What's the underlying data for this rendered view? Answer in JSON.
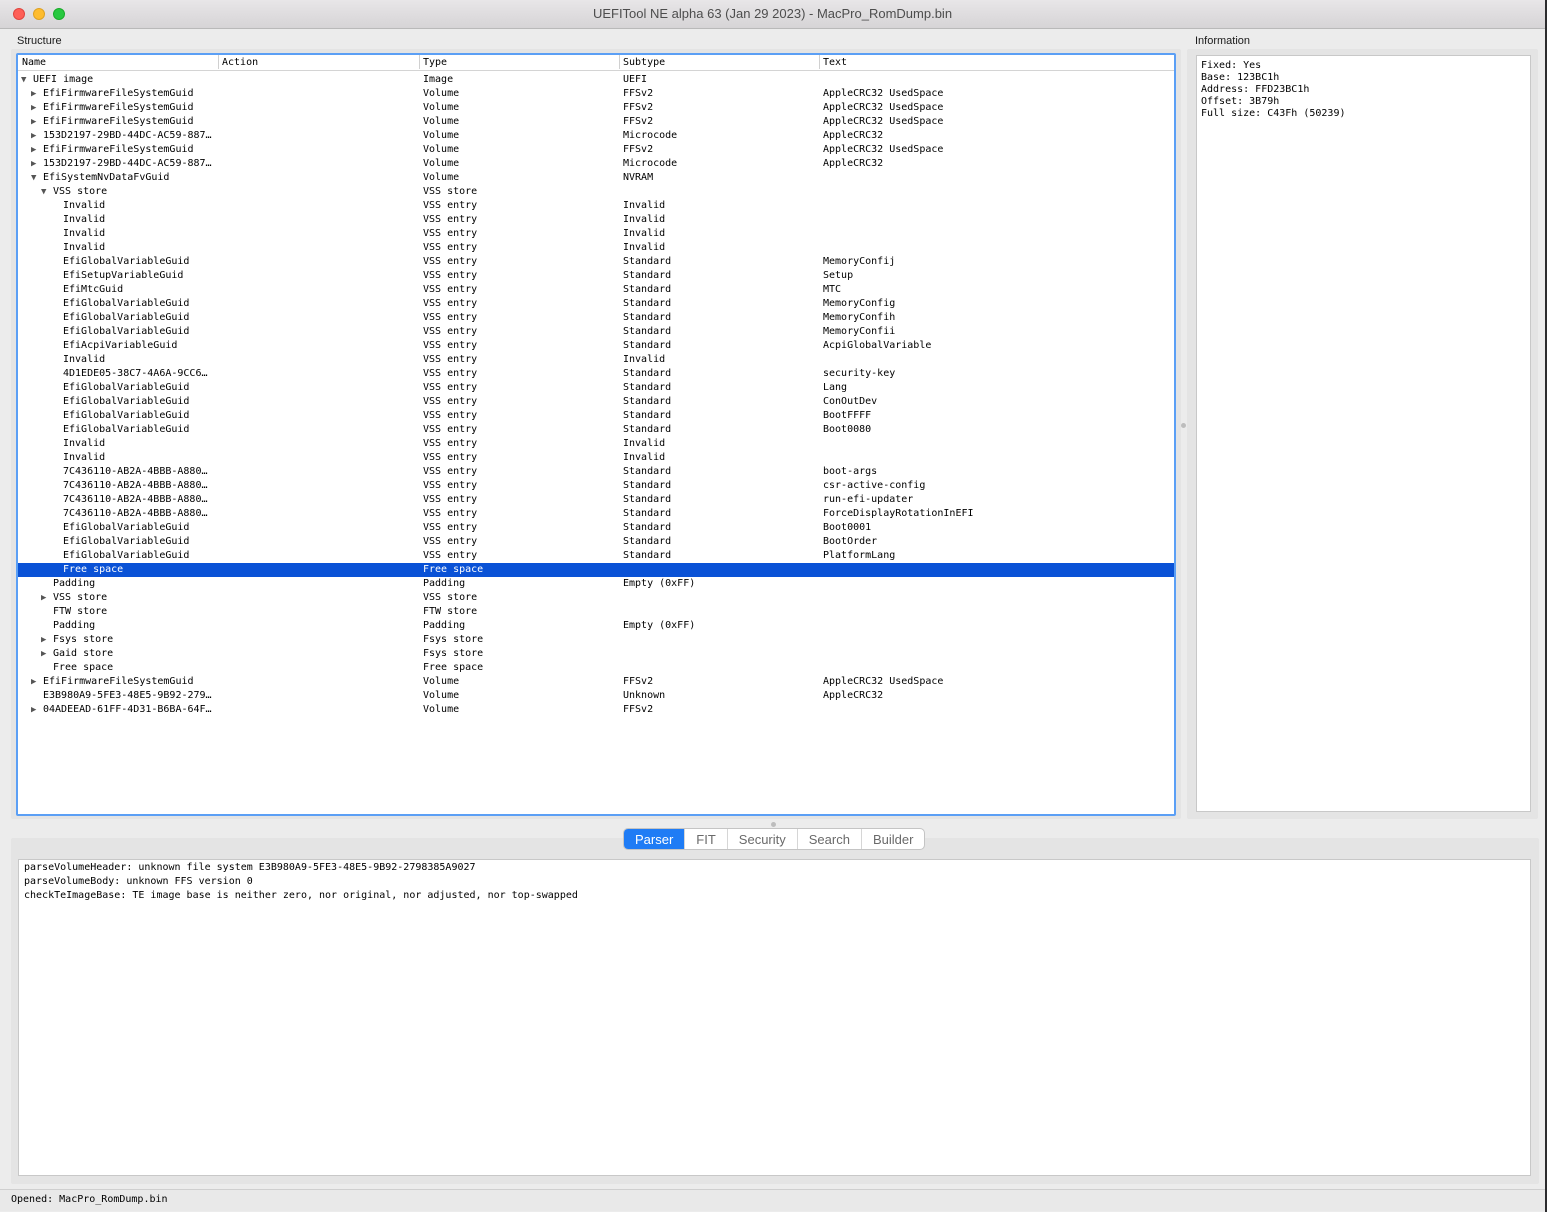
{
  "window": {
    "title": "UEFITool NE alpha 63 (Jan 29 2023) - MacPro_RomDump.bin"
  },
  "structure": {
    "label": "Structure",
    "columns": [
      "Name",
      "Action",
      "Type",
      "Subtype",
      "Text"
    ],
    "rows": [
      {
        "level": 0,
        "arrow": "down",
        "name": "UEFI image",
        "action": "",
        "type": "Image",
        "subtype": "UEFI",
        "text": ""
      },
      {
        "level": 1,
        "arrow": "right",
        "name": "EfiFirmwareFileSystemGuid",
        "action": "",
        "type": "Volume",
        "subtype": "FFSv2",
        "text": "AppleCRC32 UsedSpace"
      },
      {
        "level": 1,
        "arrow": "right",
        "name": "EfiFirmwareFileSystemGuid",
        "action": "",
        "type": "Volume",
        "subtype": "FFSv2",
        "text": "AppleCRC32 UsedSpace"
      },
      {
        "level": 1,
        "arrow": "right",
        "name": "EfiFirmwareFileSystemGuid",
        "action": "",
        "type": "Volume",
        "subtype": "FFSv2",
        "text": "AppleCRC32 UsedSpace"
      },
      {
        "level": 1,
        "arrow": "right",
        "name": "153D2197-29BD-44DC-AC59-887…",
        "action": "",
        "type": "Volume",
        "subtype": "Microcode",
        "text": "AppleCRC32"
      },
      {
        "level": 1,
        "arrow": "right",
        "name": "EfiFirmwareFileSystemGuid",
        "action": "",
        "type": "Volume",
        "subtype": "FFSv2",
        "text": "AppleCRC32 UsedSpace"
      },
      {
        "level": 1,
        "arrow": "right",
        "name": "153D2197-29BD-44DC-AC59-887…",
        "action": "",
        "type": "Volume",
        "subtype": "Microcode",
        "text": "AppleCRC32"
      },
      {
        "level": 1,
        "arrow": "down",
        "name": "EfiSystemNvDataFvGuid",
        "action": "",
        "type": "Volume",
        "subtype": "NVRAM",
        "text": ""
      },
      {
        "level": 2,
        "arrow": "down",
        "name": "VSS store",
        "action": "",
        "type": "VSS store",
        "subtype": "",
        "text": ""
      },
      {
        "level": 3,
        "arrow": "",
        "name": "Invalid",
        "action": "",
        "type": "VSS entry",
        "subtype": "Invalid",
        "text": ""
      },
      {
        "level": 3,
        "arrow": "",
        "name": "Invalid",
        "action": "",
        "type": "VSS entry",
        "subtype": "Invalid",
        "text": ""
      },
      {
        "level": 3,
        "arrow": "",
        "name": "Invalid",
        "action": "",
        "type": "VSS entry",
        "subtype": "Invalid",
        "text": ""
      },
      {
        "level": 3,
        "arrow": "",
        "name": "Invalid",
        "action": "",
        "type": "VSS entry",
        "subtype": "Invalid",
        "text": ""
      },
      {
        "level": 3,
        "arrow": "",
        "name": "EfiGlobalVariableGuid",
        "action": "",
        "type": "VSS entry",
        "subtype": "Standard",
        "text": "MemoryConfij"
      },
      {
        "level": 3,
        "arrow": "",
        "name": "EfiSetupVariableGuid",
        "action": "",
        "type": "VSS entry",
        "subtype": "Standard",
        "text": "Setup"
      },
      {
        "level": 3,
        "arrow": "",
        "name": "EfiMtcGuid",
        "action": "",
        "type": "VSS entry",
        "subtype": "Standard",
        "text": "MTC"
      },
      {
        "level": 3,
        "arrow": "",
        "name": "EfiGlobalVariableGuid",
        "action": "",
        "type": "VSS entry",
        "subtype": "Standard",
        "text": "MemoryConfig"
      },
      {
        "level": 3,
        "arrow": "",
        "name": "EfiGlobalVariableGuid",
        "action": "",
        "type": "VSS entry",
        "subtype": "Standard",
        "text": "MemoryConfih"
      },
      {
        "level": 3,
        "arrow": "",
        "name": "EfiGlobalVariableGuid",
        "action": "",
        "type": "VSS entry",
        "subtype": "Standard",
        "text": "MemoryConfii"
      },
      {
        "level": 3,
        "arrow": "",
        "name": "EfiAcpiVariableGuid",
        "action": "",
        "type": "VSS entry",
        "subtype": "Standard",
        "text": "AcpiGlobalVariable"
      },
      {
        "level": 3,
        "arrow": "",
        "name": "Invalid",
        "action": "",
        "type": "VSS entry",
        "subtype": "Invalid",
        "text": ""
      },
      {
        "level": 3,
        "arrow": "",
        "name": "4D1EDE05-38C7-4A6A-9CC6…",
        "action": "",
        "type": "VSS entry",
        "subtype": "Standard",
        "text": "security-key"
      },
      {
        "level": 3,
        "arrow": "",
        "name": "EfiGlobalVariableGuid",
        "action": "",
        "type": "VSS entry",
        "subtype": "Standard",
        "text": "Lang"
      },
      {
        "level": 3,
        "arrow": "",
        "name": "EfiGlobalVariableGuid",
        "action": "",
        "type": "VSS entry",
        "subtype": "Standard",
        "text": "ConOutDev"
      },
      {
        "level": 3,
        "arrow": "",
        "name": "EfiGlobalVariableGuid",
        "action": "",
        "type": "VSS entry",
        "subtype": "Standard",
        "text": "BootFFFF"
      },
      {
        "level": 3,
        "arrow": "",
        "name": "EfiGlobalVariableGuid",
        "action": "",
        "type": "VSS entry",
        "subtype": "Standard",
        "text": "Boot0080"
      },
      {
        "level": 3,
        "arrow": "",
        "name": "Invalid",
        "action": "",
        "type": "VSS entry",
        "subtype": "Invalid",
        "text": ""
      },
      {
        "level": 3,
        "arrow": "",
        "name": "Invalid",
        "action": "",
        "type": "VSS entry",
        "subtype": "Invalid",
        "text": ""
      },
      {
        "level": 3,
        "arrow": "",
        "name": "7C436110-AB2A-4BBB-A880…",
        "action": "",
        "type": "VSS entry",
        "subtype": "Standard",
        "text": "boot-args"
      },
      {
        "level": 3,
        "arrow": "",
        "name": "7C436110-AB2A-4BBB-A880…",
        "action": "",
        "type": "VSS entry",
        "subtype": "Standard",
        "text": "csr-active-config"
      },
      {
        "level": 3,
        "arrow": "",
        "name": "7C436110-AB2A-4BBB-A880…",
        "action": "",
        "type": "VSS entry",
        "subtype": "Standard",
        "text": "run-efi-updater"
      },
      {
        "level": 3,
        "arrow": "",
        "name": "7C436110-AB2A-4BBB-A880…",
        "action": "",
        "type": "VSS entry",
        "subtype": "Standard",
        "text": "ForceDisplayRotationInEFI"
      },
      {
        "level": 3,
        "arrow": "",
        "name": "EfiGlobalVariableGuid",
        "action": "",
        "type": "VSS entry",
        "subtype": "Standard",
        "text": "Boot0001"
      },
      {
        "level": 3,
        "arrow": "",
        "name": "EfiGlobalVariableGuid",
        "action": "",
        "type": "VSS entry",
        "subtype": "Standard",
        "text": "BootOrder"
      },
      {
        "level": 3,
        "arrow": "",
        "name": "EfiGlobalVariableGuid",
        "action": "",
        "type": "VSS entry",
        "subtype": "Standard",
        "text": "PlatformLang"
      },
      {
        "level": 3,
        "arrow": "",
        "name": "Free space",
        "action": "",
        "type": "Free space",
        "subtype": "",
        "text": "",
        "selected": true
      },
      {
        "level": 2,
        "arrow": "",
        "name": "Padding",
        "action": "",
        "type": "Padding",
        "subtype": "Empty (0xFF)",
        "text": ""
      },
      {
        "level": 2,
        "arrow": "right",
        "name": "VSS store",
        "action": "",
        "type": "VSS store",
        "subtype": "",
        "text": ""
      },
      {
        "level": 2,
        "arrow": "",
        "name": "FTW store",
        "action": "",
        "type": "FTW store",
        "subtype": "",
        "text": ""
      },
      {
        "level": 2,
        "arrow": "",
        "name": "Padding",
        "action": "",
        "type": "Padding",
        "subtype": "Empty (0xFF)",
        "text": ""
      },
      {
        "level": 2,
        "arrow": "right",
        "name": "Fsys store",
        "action": "",
        "type": "Fsys store",
        "subtype": "",
        "text": ""
      },
      {
        "level": 2,
        "arrow": "right",
        "name": "Gaid store",
        "action": "",
        "type": "Fsys store",
        "subtype": "",
        "text": ""
      },
      {
        "level": 2,
        "arrow": "",
        "name": "Free space",
        "action": "",
        "type": "Free space",
        "subtype": "",
        "text": ""
      },
      {
        "level": 1,
        "arrow": "right",
        "name": "EfiFirmwareFileSystemGuid",
        "action": "",
        "type": "Volume",
        "subtype": "FFSv2",
        "text": "AppleCRC32 UsedSpace"
      },
      {
        "level": 1,
        "arrow": "",
        "name": "E3B980A9-5FE3-48E5-9B92-279…",
        "action": "",
        "type": "Volume",
        "subtype": "Unknown",
        "text": "AppleCRC32"
      },
      {
        "level": 1,
        "arrow": "right",
        "name": "04ADEEAD-61FF-4D31-B6BA-64F…",
        "action": "",
        "type": "Volume",
        "subtype": "FFSv2",
        "text": ""
      }
    ]
  },
  "information": {
    "label": "Information",
    "lines": [
      "Fixed: Yes",
      "Base: 123BC1h",
      "Address: FFD23BC1h",
      "Offset: 3B79h",
      "Full size: C43Fh (50239)"
    ]
  },
  "tabs": [
    {
      "label": "Parser",
      "active": true
    },
    {
      "label": "FIT",
      "active": false
    },
    {
      "label": "Security",
      "active": false
    },
    {
      "label": "Search",
      "active": false
    },
    {
      "label": "Builder",
      "active": false
    }
  ],
  "messages": [
    "parseVolumeHeader: unknown file system E3B980A9-5FE3-48E5-9B92-2798385A9027",
    "parseVolumeBody: unknown FFS version 0",
    "checkTeImageBase: TE image base is neither zero, nor original, nor adjusted, nor top-swapped"
  ],
  "status": {
    "text": "Opened: MacPro_RomDump.bin"
  },
  "icons": {
    "expanded": "triangle-down-icon",
    "collapsed": "triangle-right-icon"
  },
  "colors": {
    "selection": "#0a52d6",
    "focus_ring": "#5b9ff5",
    "active_tab": "#1f7cf5"
  }
}
